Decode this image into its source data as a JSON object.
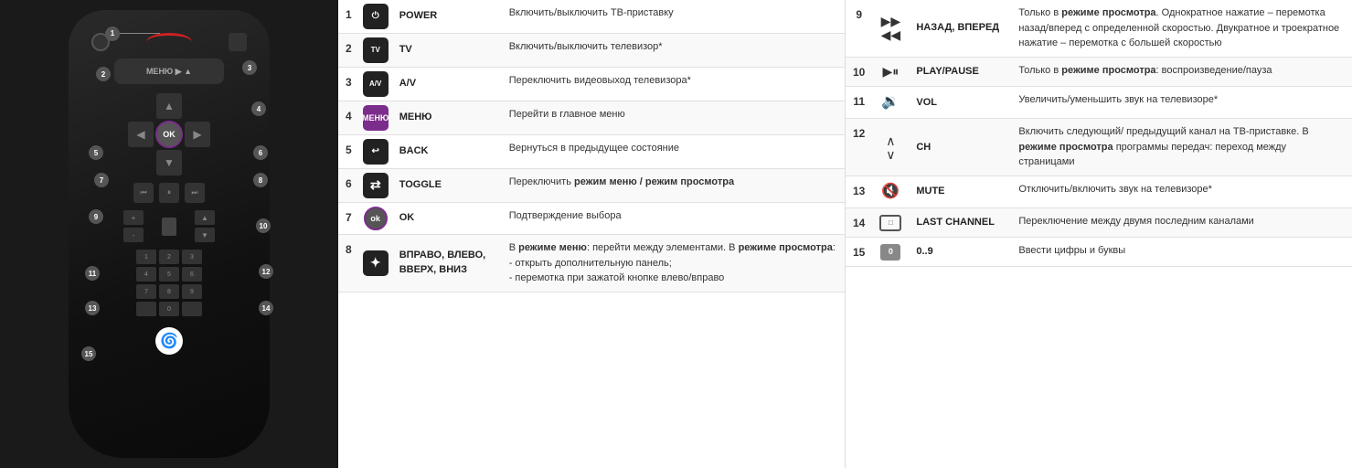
{
  "remote": {
    "labels": [
      "1",
      "2",
      "3",
      "4",
      "5",
      "6",
      "7",
      "8",
      "9",
      "10",
      "11",
      "12",
      "13",
      "14",
      "15"
    ]
  },
  "table": {
    "left_rows": [
      {
        "num": "1",
        "icon_type": "power",
        "name": "POWER",
        "desc": "Включить/выключить ТВ-приставку"
      },
      {
        "num": "2",
        "icon_type": "tv",
        "name": "TV",
        "desc": "Включить/выключить телевизор*"
      },
      {
        "num": "3",
        "icon_type": "av",
        "name": "A/V",
        "desc": "Переключить видеовыход телевизора*"
      },
      {
        "num": "4",
        "icon_type": "menu",
        "name": "МЕНЮ",
        "desc": "Перейти в главное меню"
      },
      {
        "num": "5",
        "icon_type": "back",
        "name": "BACK",
        "desc": "Вернуться в предыдущее состояние"
      },
      {
        "num": "6",
        "icon_type": "toggle",
        "name": "TOGGLE",
        "desc_bold_parts": [
          {
            "text": "Переключить ",
            "bold": false
          },
          {
            "text": "режим меню / режим просмотра",
            "bold": true
          }
        ],
        "desc": "Переключить режим меню / режим просмотра"
      },
      {
        "num": "7",
        "icon_type": "ok",
        "name": "OK",
        "desc": "Подтверждение выбора"
      },
      {
        "num": "8",
        "icon_type": "arrows",
        "name": "ВПРАВО, ВЛЕВО, ВВЕРХ, ВНИЗ",
        "desc_mixed": true,
        "desc": "В режиме меню: перейти между элементами. В режиме просмотра: - открыть дополнительную панель; - перемотка при зажатой кнопке влево/вправо"
      }
    ],
    "right_rows": [
      {
        "num": "9",
        "icon_type": "fastforward",
        "name": "НАЗАД, ВПЕРЕД",
        "desc": "Только в режиме просмотра. Однократное нажатие – перемотка назад/вперед с определенной скоростью. Двукратное и троекратное нажатие – перемотка с большей скоростью"
      },
      {
        "num": "10",
        "icon_type": "playpause",
        "name": "PLAY/PAUSE",
        "desc_mixed": true,
        "desc": "Только в режиме просмотра: воспроизведение/пауза"
      },
      {
        "num": "11",
        "icon_type": "vol",
        "name": "VOL",
        "desc": "Увеличить/уменьшить звук на телевизоре*"
      },
      {
        "num": "12",
        "icon_type": "ch",
        "name": "CH",
        "desc_mixed": true,
        "desc": "Включить следующий/ предыдущий канал на ТВ-приставке. В режиме просмотра программы передач: переход между страницами"
      },
      {
        "num": "13",
        "icon_type": "mute",
        "name": "MUTE",
        "desc": "Отключить/включить звук на телевизоре*"
      },
      {
        "num": "14",
        "icon_type": "lastchannel",
        "name": "LAST CHANNEL",
        "desc": "Переключение между двумя последним каналами"
      },
      {
        "num": "15",
        "icon_type": "zero",
        "name": "0..9",
        "desc": "Ввести цифры и буквы"
      }
    ]
  }
}
